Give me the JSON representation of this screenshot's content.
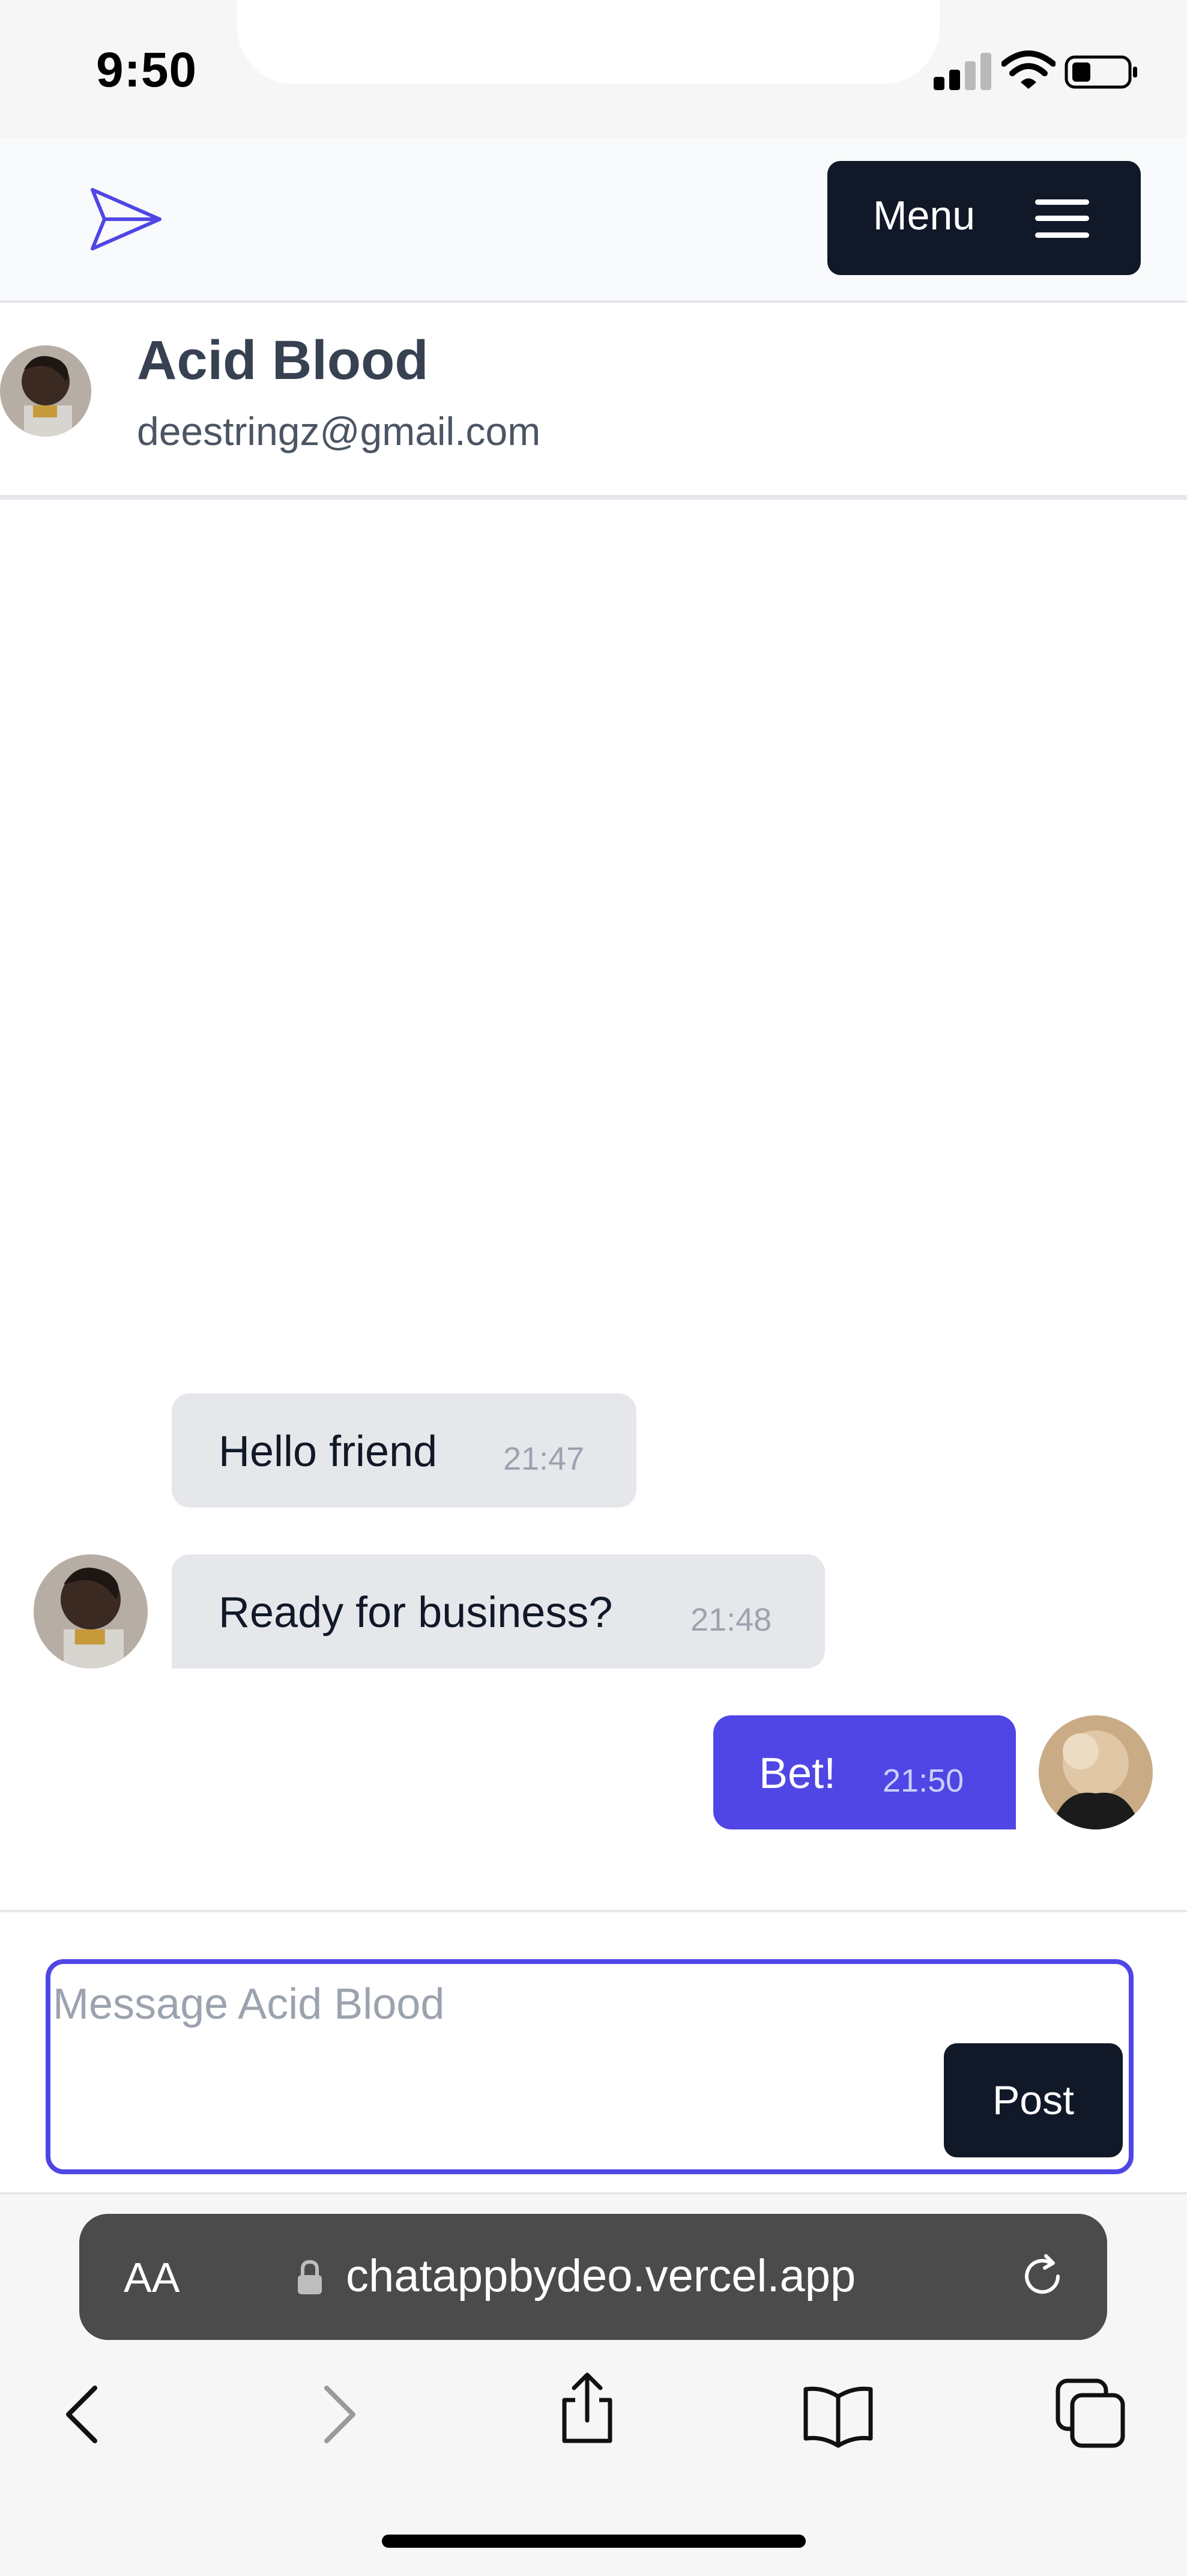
{
  "status_bar": {
    "time": "9:50"
  },
  "header": {
    "menu_label": "Menu"
  },
  "contact": {
    "name": "Acid Blood",
    "email": "deestringz@gmail.com"
  },
  "messages": [
    {
      "text": "Hello friend",
      "time": "21:47",
      "direction": "incoming"
    },
    {
      "text": "Ready for business?",
      "time": "21:48",
      "direction": "incoming"
    },
    {
      "text": "Bet!",
      "time": "21:50",
      "direction": "outgoing"
    }
  ],
  "composer": {
    "placeholder": "Message Acid Blood",
    "value": "",
    "post_label": "Post"
  },
  "browser": {
    "text_size_label": "AA",
    "url": "chatappbydeo.vercel.app"
  },
  "colors": {
    "accent": "#4f46e5",
    "dark": "#111827",
    "bubble_incoming": "#e5e7eb"
  },
  "icons": [
    "paper-plane-icon",
    "hamburger-icon",
    "lock-icon",
    "reload-icon",
    "back-icon",
    "forward-icon",
    "share-icon",
    "bookmarks-icon",
    "tabs-icon"
  ]
}
